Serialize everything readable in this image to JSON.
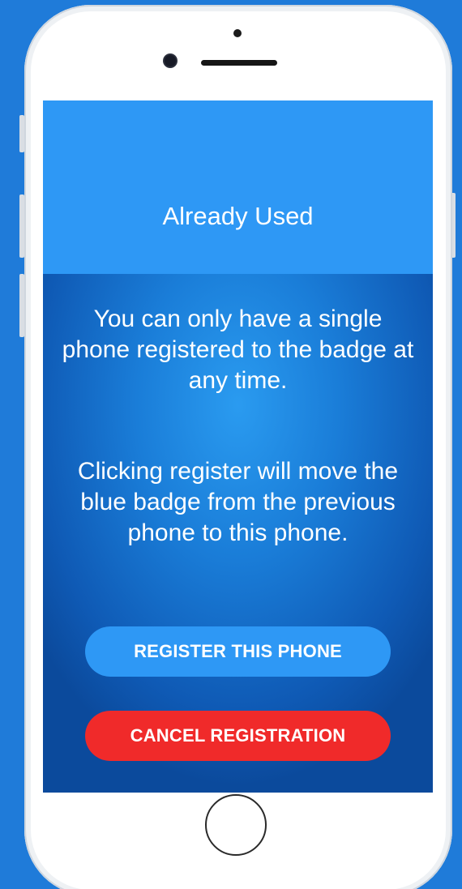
{
  "screen": {
    "title": "Already Used",
    "message_1": "You can only have a single phone registered to the badge at any time.",
    "message_2": "Clicking register will move the blue badge from the previous phone to this phone.",
    "register_button_label": "REGISTER THIS PHONE",
    "cancel_button_label": "CANCEL REGISTRATION"
  },
  "colors": {
    "background": "#1f7bd9",
    "header": "#2e98f5",
    "register_button": "#2e98f5",
    "cancel_button": "#f02a2a",
    "text": "#ffffff"
  }
}
